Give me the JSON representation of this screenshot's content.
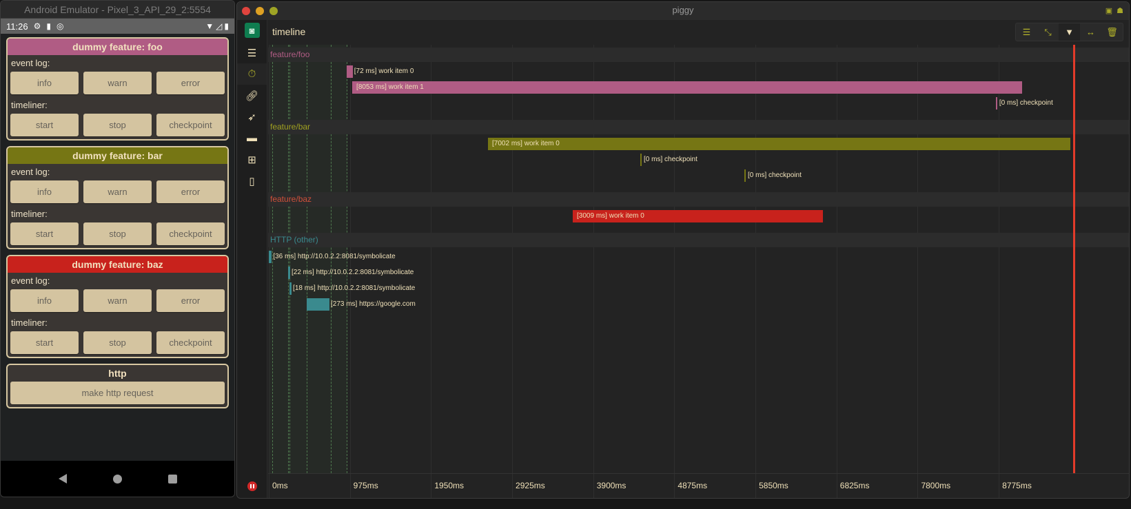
{
  "emulator": {
    "window_title": "Android Emulator - Pixel_3_API_29_2:5554",
    "status_bar": {
      "time": "11:26",
      "left_icons": [
        "gear-icon",
        "sd-card-icon",
        "data-saver-icon"
      ],
      "right_icons": [
        "wifi-icon",
        "signal-icon",
        "battery-icon"
      ]
    },
    "cards": [
      {
        "title": "dummy feature: foo",
        "color": "#b05c84",
        "event_log_label": "event log:",
        "event_buttons": [
          "info",
          "warn",
          "error"
        ],
        "timeliner_label": "timeliner:",
        "timeliner_buttons": [
          "start",
          "stop",
          "checkpoint"
        ]
      },
      {
        "title": "dummy feature: bar",
        "color": "#767614",
        "event_log_label": "event log:",
        "event_buttons": [
          "info",
          "warn",
          "error"
        ],
        "timeliner_label": "timeliner:",
        "timeliner_buttons": [
          "start",
          "stop",
          "checkpoint"
        ]
      },
      {
        "title": "dummy feature: baz",
        "color": "#c8221c",
        "event_log_label": "event log:",
        "event_buttons": [
          "info",
          "warn",
          "error"
        ],
        "timeliner_label": "timeliner:",
        "timeliner_buttons": [
          "start",
          "stop",
          "checkpoint"
        ]
      }
    ],
    "http_card": {
      "title": "http",
      "button": "make http request"
    },
    "nav": [
      "back",
      "home",
      "recents"
    ]
  },
  "piggy": {
    "window_title": "piggy",
    "header_title": "timeline",
    "titlebar_icons": [
      "js-icon",
      "android-icon"
    ],
    "sidebar": [
      {
        "icon": "list-icon",
        "active": false
      },
      {
        "icon": "stopwatch-icon",
        "active": true
      },
      {
        "icon": "link-icon",
        "active": false
      },
      {
        "icon": "rocket-icon",
        "active": false
      },
      {
        "icon": "bed-icon",
        "active": false
      },
      {
        "icon": "sitemap-icon",
        "active": false
      },
      {
        "icon": "mobile-icon",
        "active": false
      }
    ],
    "toolbar": [
      {
        "icon": "align-center-icon",
        "active": false
      },
      {
        "icon": "compress-icon",
        "active": false
      },
      {
        "icon": "filter-icon",
        "active": true
      },
      {
        "icon": "arrows-h-icon",
        "active": false
      },
      {
        "icon": "trash-icon",
        "active": false
      }
    ]
  },
  "chart_data": {
    "type": "timeline",
    "x_unit": "ms",
    "xlim": [
      0,
      9700
    ],
    "ticks": [
      "0ms",
      "975ms",
      "1950ms",
      "2925ms",
      "3900ms",
      "4875ms",
      "5850ms",
      "6825ms",
      "7800ms",
      "8775ms"
    ],
    "tick_values": [
      0,
      975,
      1950,
      2925,
      3900,
      4875,
      5850,
      6825,
      7800,
      8775
    ],
    "now_ms": 9670,
    "markers_ms": [
      40,
      232,
      249,
      456,
      746,
      937
    ],
    "groups": [
      {
        "name": "feature/foo",
        "color": "#b05c84",
        "items": [
          {
            "label": "[72 ms] work item 0",
            "start": 937,
            "duration": 72
          },
          {
            "label": "[8053 ms] work item 1",
            "start": 1003,
            "duration": 8053
          },
          {
            "label": "[0 ms] checkpoint",
            "start": 8740,
            "duration": 0
          }
        ]
      },
      {
        "name": "feature/bar",
        "color": "#767614",
        "items": [
          {
            "label": "[7002 ms] work item 0",
            "start": 2635,
            "duration": 7002
          },
          {
            "label": "[0 ms] checkpoint",
            "start": 4466,
            "duration": 0
          },
          {
            "label": "[0 ms] checkpoint",
            "start": 5717,
            "duration": 0
          }
        ]
      },
      {
        "name": "feature/baz",
        "color": "#c8221c",
        "items": [
          {
            "label": "[3009 ms] work item 0",
            "start": 3654,
            "duration": 3009
          }
        ]
      },
      {
        "name": "HTTP (other)",
        "color": "#3a8a8e",
        "items": [
          {
            "label": "[36 ms] http://10.0.2.2:8081/symbolicate",
            "start": 0,
            "duration": 36
          },
          {
            "label": "[22 ms] http://10.0.2.2:8081/symbolicate",
            "start": 232,
            "duration": 22
          },
          {
            "label": "[18 ms] http://10.0.2.2:8081/symbolicate",
            "start": 249,
            "duration": 18
          },
          {
            "label": "[273 ms] https://google.com",
            "start": 456,
            "duration": 273
          }
        ]
      }
    ]
  }
}
